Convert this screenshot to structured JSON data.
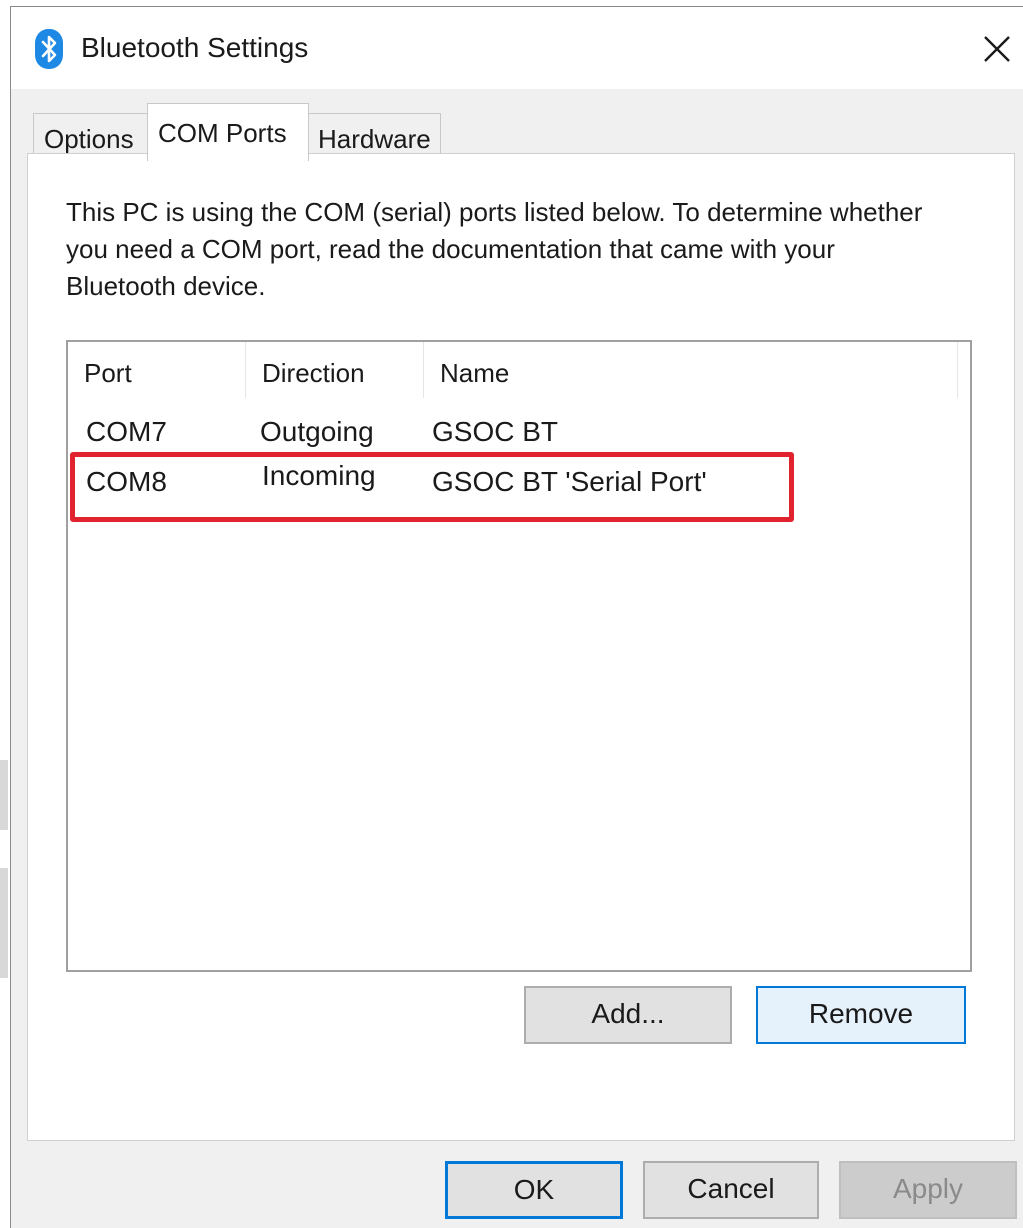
{
  "window": {
    "title": "Bluetooth Settings",
    "icon": "bluetooth-icon",
    "close_icon": "close-icon"
  },
  "tabs": [
    {
      "label": "Options",
      "active": false
    },
    {
      "label": "COM Ports",
      "active": true
    },
    {
      "label": "Hardware",
      "active": false
    }
  ],
  "description": "This PC is using the COM (serial) ports listed below. To determine whether you need a COM port, read the documentation that came with your Bluetooth device.",
  "ports_table": {
    "columns": [
      "Port",
      "Direction",
      "Name"
    ],
    "rows": [
      {
        "port": "COM7",
        "direction": "Outgoing",
        "name": "GSOC BT"
      },
      {
        "port": "COM8",
        "direction": "Incoming",
        "name": "GSOC BT 'Serial Port'",
        "highlighted": true
      }
    ]
  },
  "panel_buttons": {
    "add": "Add...",
    "remove": "Remove"
  },
  "dialog_buttons": {
    "ok": "OK",
    "cancel": "Cancel",
    "apply": "Apply"
  },
  "colors": {
    "highlight_box": "#e0232e",
    "focus_border": "#0078d7",
    "bluetooth_blue": "#1e88e5"
  }
}
